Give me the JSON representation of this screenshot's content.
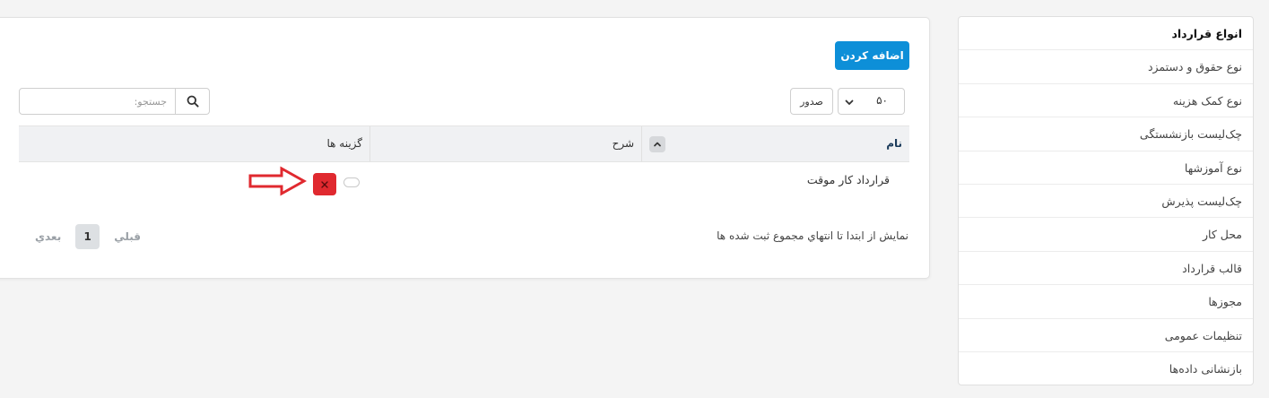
{
  "sidebar": {
    "items": [
      {
        "label": "انواع قرارداد",
        "active": true
      },
      {
        "label": "نوع حقوق و دستمزد"
      },
      {
        "label": "نوع کمک هزینه"
      },
      {
        "label": "چک‌لیست بازنشستگی"
      },
      {
        "label": "نوع آموزشها"
      },
      {
        "label": "چک‌لیست پذیرش"
      },
      {
        "label": "محل کار"
      },
      {
        "label": "قالب قرارداد"
      },
      {
        "label": "مجوزها"
      },
      {
        "label": "تنظیمات عمومی"
      },
      {
        "label": "بازنشانی داده‌ها"
      }
    ]
  },
  "toolbar": {
    "add_label": "اضافه کردن",
    "page_length": "۵۰",
    "export_label": "صدور",
    "search_placeholder": "جستجو:"
  },
  "table": {
    "columns": [
      "نام",
      "شرح",
      "گزینه ها"
    ],
    "rows": [
      {
        "name": "قرارداد کار موقت",
        "description": ""
      }
    ]
  },
  "footer": {
    "info": "نمایش از ابتدا تا انتهاي مجموع ثبت شده ها",
    "prev_label": "قبلي",
    "page": "1",
    "next_label": "بعدي"
  },
  "colors": {
    "accent": "#0d8fd8",
    "danger": "#e0292f",
    "annotation": "#e0292f"
  }
}
